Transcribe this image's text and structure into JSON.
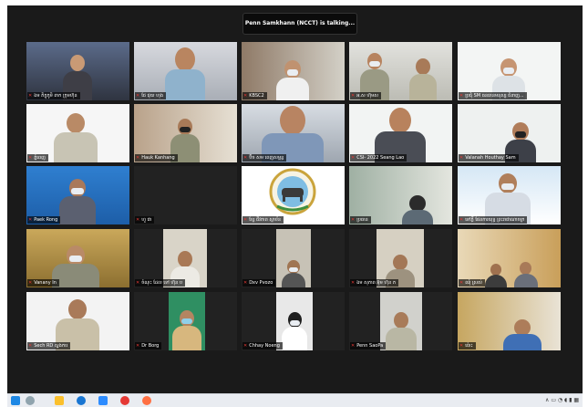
{
  "status": {
    "talking": "Penn Samkhann (NCCT) is talking..."
  },
  "tiles": [
    {
      "name": "ឯម ភិក្ខុភូមិ ពាក ក្រុមហ៊ុន"
    },
    {
      "name": "ជែ ជុយ ហុង"
    },
    {
      "name": "KBSC2"
    },
    {
      "name": "អ.ស ហ៊ុមស"
    },
    {
      "name": "ប្រជុំ SM ធនធានមនុស្ស ជំនាញ..."
    },
    {
      "name": "ភ្នំពេញ"
    },
    {
      "name": "Hauk Kanhang"
    },
    {
      "name": "ប៊ិច សម ពេញសម្ពន្ធ"
    },
    {
      "name": "CSI- 2022 Seang Lao"
    },
    {
      "name": "Valanah Houthay Sam"
    },
    {
      "name": "Paek Rong"
    },
    {
      "name": "ហួ ជា"
    },
    {
      "name": "ខ្សែ ជីវភាព ស្ថាប័ន"
    },
    {
      "name": "ប្រធាន"
    },
    {
      "name": "ទៅភ្លឺ ផែនការយុទ្ធ ព្រះរាជាណាចក្រ"
    },
    {
      "name": "Vanany In"
    },
    {
      "name": "ចំណុះ ដែល ទៅ ហ៊ុន ប"
    },
    {
      "name": "Dxv Pvozo"
    },
    {
      "name": "ឯម សុភាព អ៊ុម ហ៊ុន ភ"
    },
    {
      "name": "ឈុំ ស្រស់"
    },
    {
      "name": "Sech RD ស្នងការ"
    },
    {
      "name": "Dr Borg"
    },
    {
      "name": "Chhay Noeng"
    },
    {
      "name": "Penn SaoPa"
    },
    {
      "name": "ប៉ោះ"
    }
  ],
  "taskbar": {
    "icons": [
      "windows-icon",
      "search-icon",
      "explorer-icon",
      "edge-icon",
      "zoom-icon",
      "chrome-icon"
    ],
    "tray": "∧ ▭ ◔ ◖ ▮ ▦"
  }
}
